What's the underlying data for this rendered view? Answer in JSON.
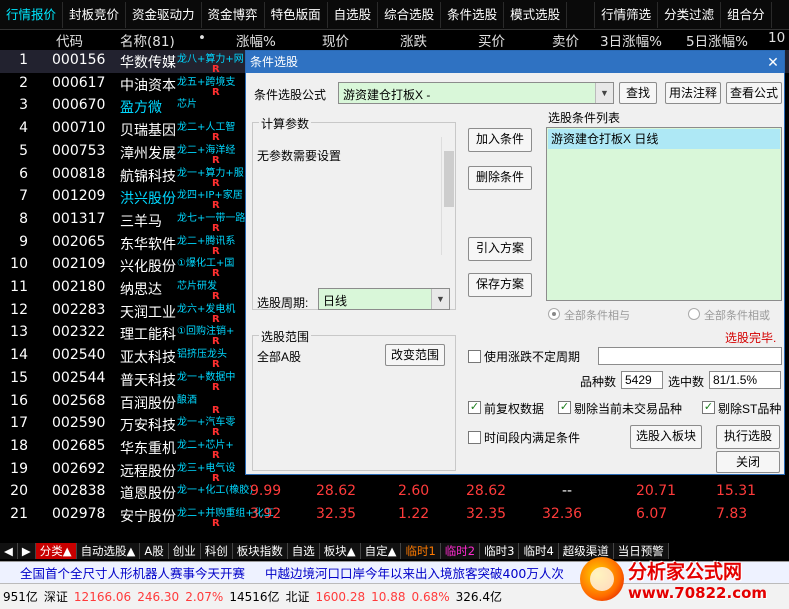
{
  "top_tabs": [
    "行情报价",
    "封板竞价",
    "资金驱动力",
    "资金博弈",
    "特色版面",
    "自选股",
    "综合选股",
    "条件选股",
    "模式选股",
    "",
    "行情筛选",
    "分类过滤",
    "组合分"
  ],
  "columns": {
    "idx": "",
    "code": "代码",
    "name": "名称(81)",
    "dot": "•",
    "chg_pct": "涨幅%",
    "price": "现价",
    "chg": "涨跌",
    "bid": "买价",
    "ask": "卖价",
    "d3": "3日涨幅%",
    "d5": "5日涨幅%",
    "more": "10"
  },
  "rows": [
    {
      "idx": "1",
      "code": "000156",
      "name": "华数传媒",
      "tag": "龙八+算力+网",
      "name_cyan": false,
      "r": "R"
    },
    {
      "idx": "2",
      "code": "000617",
      "name": "中油资本",
      "tag": "龙五+跨境支",
      "name_cyan": false,
      "r": "R"
    },
    {
      "idx": "3",
      "code": "000670",
      "name": "盈方微",
      "tag": "芯片",
      "name_cyan": true,
      "r": ""
    },
    {
      "idx": "4",
      "code": "000710",
      "name": "贝瑞基因",
      "tag": "龙二+人工智",
      "name_cyan": false,
      "r": "R"
    },
    {
      "idx": "5",
      "code": "000753",
      "name": "漳州发展",
      "tag": "龙二+海洋经",
      "name_cyan": false,
      "r": "R"
    },
    {
      "idx": "6",
      "code": "000818",
      "name": "航锦科技",
      "tag": "龙一+算力+服",
      "name_cyan": false,
      "r": "R"
    },
    {
      "idx": "7",
      "code": "001209",
      "name": "洪兴股份",
      "tag": "龙四+IP+家居",
      "name_cyan": true,
      "r": "R"
    },
    {
      "idx": "8",
      "code": "001317",
      "name": "三羊马",
      "tag": "龙七+一带一路",
      "name_cyan": false,
      "r": "R"
    },
    {
      "idx": "9",
      "code": "002065",
      "name": "东华软件",
      "tag": "龙二+腾讯系",
      "name_cyan": false,
      "r": "R"
    },
    {
      "idx": "10",
      "code": "002109",
      "name": "兴化股份",
      "tag": "①爆化工+国",
      "name_cyan": false,
      "r": "R"
    },
    {
      "idx": "11",
      "code": "002180",
      "name": "纳思达",
      "tag": "芯片研发",
      "name_cyan": false,
      "r": "R"
    },
    {
      "idx": "12",
      "code": "002283",
      "name": "天润工业",
      "tag": "龙六+发电机",
      "name_cyan": false,
      "r": "R"
    },
    {
      "idx": "13",
      "code": "002322",
      "name": "理工能科",
      "tag": "①回购注销+",
      "name_cyan": false,
      "r": "R"
    },
    {
      "idx": "14",
      "code": "002540",
      "name": "亚太科技",
      "tag": "铝挤压龙头",
      "name_cyan": false,
      "r": "R"
    },
    {
      "idx": "15",
      "code": "002544",
      "name": "普天科技",
      "tag": "龙一+数据中",
      "name_cyan": false,
      "r": "R"
    },
    {
      "idx": "16",
      "code": "002568",
      "name": "百润股份",
      "tag": "酿酒",
      "name_cyan": false,
      "r": "R"
    },
    {
      "idx": "17",
      "code": "002590",
      "name": "万安科技",
      "tag": "龙一+汽车零",
      "name_cyan": false,
      "r": "R"
    },
    {
      "idx": "18",
      "code": "002685",
      "name": "华东重机",
      "tag": "龙二+芯片+",
      "name_cyan": false,
      "r": "R"
    },
    {
      "idx": "19",
      "code": "002692",
      "name": "远程股份",
      "tag": "龙三+电气设",
      "name_cyan": false,
      "r": "R"
    },
    {
      "idx": "20",
      "code": "002838",
      "name": "道恩股份",
      "tag": "龙一+化工(橡胶)",
      "name_cyan": false,
      "r": "",
      "chg_pct": "9.99",
      "price": "28.62",
      "chg": "2.60",
      "bid": "28.62",
      "ask": "--",
      "d3": "20.71",
      "d5": "15.31"
    },
    {
      "idx": "21",
      "code": "002978",
      "name": "安宁股份",
      "tag": "龙二+并购重组+化工",
      "name_cyan": false,
      "r": "R",
      "chg_pct": "3.92",
      "price": "32.35",
      "chg": "1.22",
      "bid": "32.35",
      "ask": "32.36",
      "d3": "6.07",
      "d5": "7.83"
    }
  ],
  "bottom_tabs": [
    "◀",
    "▶",
    "分类▲",
    "自动选股▲",
    "A股",
    "创业",
    "科创",
    "板块指数",
    "自选",
    "板块▲",
    "自定▲",
    "临时1",
    "临时2",
    "临时3",
    "临时4",
    "超级渠道",
    "当日预警"
  ],
  "ticker": [
    "全国首个全尺寸人形机器人赛事今天开赛",
    "中越边境河口口岸今年以来出入境旅客突破400万人次"
  ],
  "status": [
    "951亿",
    "深证",
    "12166.06",
    "246.30",
    "2.07%",
    "14516亿",
    "北证",
    "1600.28",
    "10.88",
    "0.68%",
    "326.4亿"
  ],
  "watermark": {
    "title": "分析家公式网",
    "url": "www.70822.com"
  },
  "dialog": {
    "title": "条件选股",
    "close_glyph": "✕",
    "formula_label": "条件选股公式",
    "formula_value": "游资建仓打板X  -",
    "btn_find": "查找",
    "btn_usage": "用法注释",
    "btn_view": "查看公式",
    "params_title": "计算参数",
    "params_text": "无参数需要设置",
    "period_label": "选股周期:",
    "period_value": "日线",
    "btn_add": "加入条件",
    "btn_delete": "删除条件",
    "btn_import": "引入方案",
    "btn_save": "保存方案",
    "cond_list_label": "选股条件列表",
    "cond_items": [
      "游资建仓打板X  日线"
    ],
    "radio_and": "全部条件相与",
    "radio_or": "全部条件相或",
    "done_text": "选股完毕.",
    "scope_title": "选股范围",
    "scope_value": "全部A股",
    "btn_change_scope": "改变范围",
    "use_uncertain": "使用涨跌不定周期",
    "count_label": "品种数",
    "count_value": "5429",
    "picked_label": "选中数",
    "picked_value": "81/1.5%",
    "chk_restore": "前复权数据",
    "chk_exclude_untraded": "剔除当前未交易品种",
    "chk_exclude_st": "剔除ST品种",
    "chk_time_range": "时间段内满足条件",
    "btn_to_block": "选股入板块",
    "btn_run": "执行选股",
    "btn_close": "关闭"
  }
}
